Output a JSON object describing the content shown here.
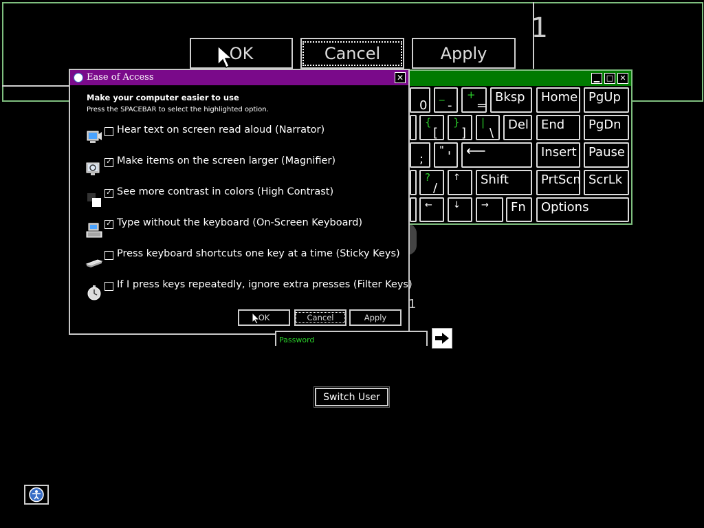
{
  "magnifier": {
    "ok_label": "OK",
    "cancel_label": "Cancel",
    "apply_label": "Apply",
    "digit": "1"
  },
  "keyboard": {
    "keys": {
      "k0": "0",
      "minus_top": "_",
      "minus_bot": "-",
      "plus_top": "+",
      "plus_bot": "=",
      "bksp": "Bksp",
      "home": "Home",
      "pgup": "PgUp",
      "lbrace_top": "{",
      "lbrace_bot": "[",
      "rbrace_top": "}",
      "rbrace_bot": "]",
      "pipe_top": "|",
      "pipe_bot": "\\",
      "del": "Del",
      "end": "End",
      "pgdn": "PgDn",
      "semi_bot": ";",
      "quote_top": "\"",
      "quote_bot": "'",
      "enter": "⟵",
      "insert": "Insert",
      "pause": "Pause",
      "q_top": "?",
      "q_bot": "/",
      "up": "↑",
      "shift": "Shift",
      "prtscn": "PrtScn",
      "scrlk": "ScrLk",
      "left": "←",
      "down": "↓",
      "right": "→",
      "fn": "Fn",
      "options": "Options"
    }
  },
  "dialog": {
    "title": "Ease of Access",
    "heading": "Make your computer easier to use",
    "subheading": "Press the SPACEBAR to select the highlighted option.",
    "options": [
      {
        "label": "Hear text on screen read aloud (Narrator)",
        "checked": false,
        "icon": "narrator-icon"
      },
      {
        "label": "Make items on the screen larger (Magnifier)",
        "checked": true,
        "icon": "magnifier-icon"
      },
      {
        "label": "See more contrast in colors (High Contrast)",
        "checked": true,
        "icon": "high-contrast-icon"
      },
      {
        "label": "Type without the keyboard (On-Screen Keyboard)",
        "checked": true,
        "icon": "keyboard-icon"
      },
      {
        "label": "Press keyboard shortcuts one key at a time (Sticky Keys)",
        "checked": false,
        "icon": "sticky-keys-icon"
      },
      {
        "label": "If I press keys repeatedly, ignore extra presses (Filter Keys)",
        "checked": false,
        "icon": "filter-keys-icon"
      }
    ],
    "ok_label": "OK",
    "cancel_label": "Cancel",
    "apply_label": "Apply",
    "close_glyph": "✕"
  },
  "login": {
    "password_placeholder": "Password",
    "switch_user_label": "Switch User",
    "behind_digit": "1"
  },
  "colors": {
    "dialog_titlebar": "#7a0a8a",
    "osk_titlebar": "#007a00",
    "accent_green": "#2bd12b"
  }
}
